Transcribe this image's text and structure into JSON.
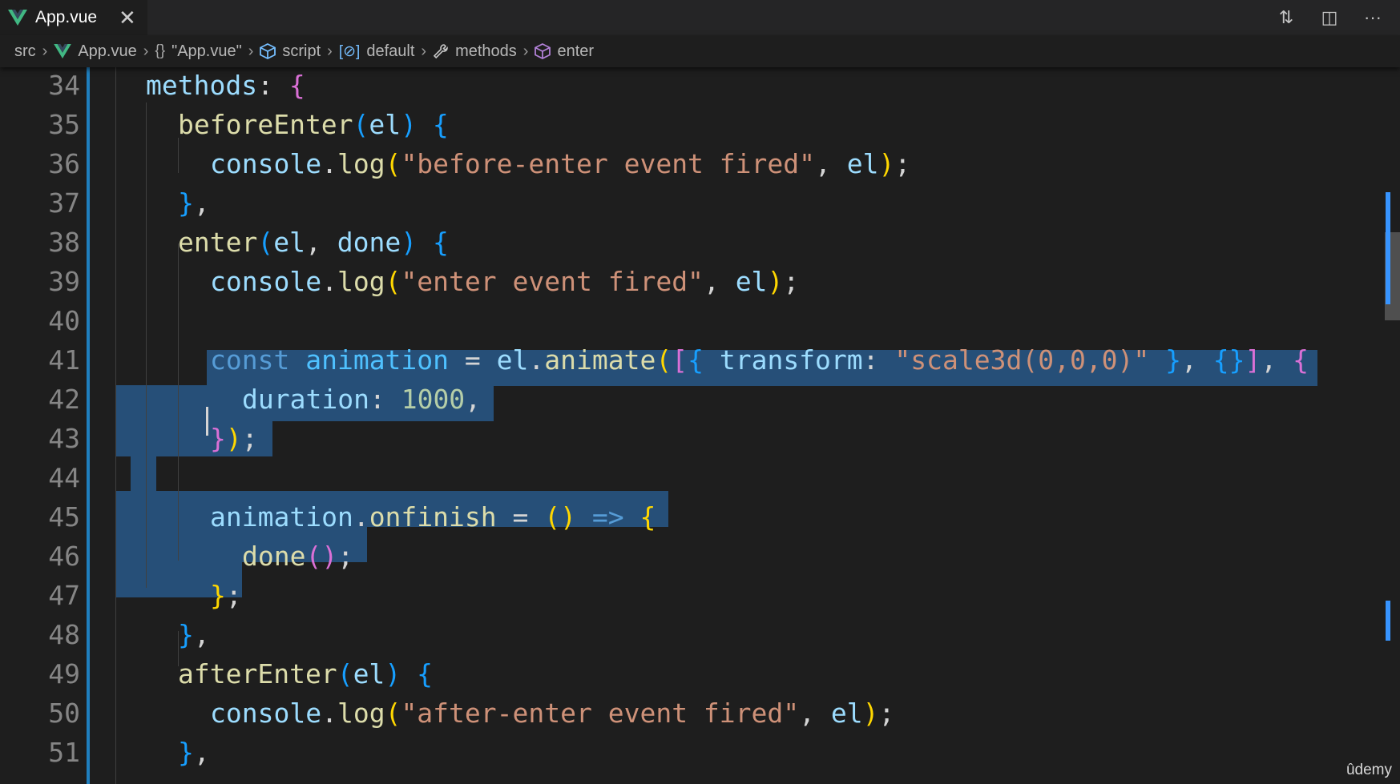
{
  "tab": {
    "label": "App.vue",
    "close": "✕"
  },
  "actions": {
    "compare": "⇅",
    "split": "◫",
    "more": "···"
  },
  "breadcrumb": {
    "items": [
      "src",
      "App.vue",
      "\"App.vue\"",
      "script",
      "default",
      "methods",
      "enter"
    ],
    "icons": [
      "",
      "V",
      "{}",
      "⬡",
      "[⊘]",
      "🔧",
      "⬡"
    ]
  },
  "lines": [
    {
      "n": "34",
      "html": "<span class='var'>methods</span><span class='punc'>: </span><span class='brk2'>{</span>"
    },
    {
      "n": "35",
      "html": "  <span class='fn'>beforeEnter</span><span class='brk3'>(</span><span class='var'>el</span><span class='brk3'>)</span> <span class='brk3'>{</span>"
    },
    {
      "n": "36",
      "html": "    <span class='var'>console</span>.<span class='fn'>log</span><span class='brk1'>(</span><span class='str'>\"before-enter event fired\"</span>, <span class='var'>el</span><span class='brk1'>)</span>;"
    },
    {
      "n": "37",
      "html": "  <span class='brk3'>}</span>,"
    },
    {
      "n": "38",
      "html": "  <span class='fn'>enter</span><span class='brk3'>(</span><span class='var'>el</span>, <span class='var'>done</span><span class='brk3'>)</span> <span class='brk3'>{</span>"
    },
    {
      "n": "39",
      "html": "    <span class='var'>console</span>.<span class='fn'>log</span><span class='brk1'>(</span><span class='str'>\"enter event fired\"</span>, <span class='var'>el</span><span class='brk1'>)</span>;"
    },
    {
      "n": "40",
      "html": ""
    },
    {
      "n": "41",
      "html": "    <span class='kw'>const</span> <span class='con'>animation</span> = <span class='var'>el</span>.<span class='fn'>animate</span><span class='brk1'>(</span><span class='brk2'>[</span><span class='brk3'>{</span> <span class='var'>transform</span>: <span class='str'>\"scale3d(0,0,0)\"</span> <span class='brk3'>}</span>, <span class='brk3'>{}</span><span class='brk2'>]</span>, <span class='brk2'>{</span>"
    },
    {
      "n": "42",
      "html": "      <span class='var'>duration</span>: <span class='num'>1000</span>,"
    },
    {
      "n": "43",
      "html": "    <span class='brk2'>}</span><span class='brk1'>)</span>;"
    },
    {
      "n": "44",
      "html": ""
    },
    {
      "n": "45",
      "html": "    <span class='var'>animation</span>.<span class='fn'>onfinish</span> = <span class='brk1'>()</span> <span class='kw'>=&gt;</span> <span class='brk1'>{</span>"
    },
    {
      "n": "46",
      "html": "      <span class='fn'>done</span><span class='brk2'>()</span>;"
    },
    {
      "n": "47",
      "html": "    <span class='brk1'>}</span>;"
    },
    {
      "n": "48",
      "html": "  <span class='brk3'>}</span>,"
    },
    {
      "n": "49",
      "html": "  <span class='fn'>afterEnter</span><span class='brk3'>(</span><span class='var'>el</span><span class='brk3'>)</span> <span class='brk3'>{</span>"
    },
    {
      "n": "50",
      "html": "    <span class='var'>console</span>.<span class='fn'>log</span><span class='brk1'>(</span><span class='str'>\"after-enter event fired\"</span>, <span class='var'>el</span><span class='brk1'>)</span>;"
    },
    {
      "n": "51",
      "html": "  <span class='brk3'>}</span>,"
    }
  ],
  "watermark": "ûdemy",
  "colors": {
    "selection": "#264f78",
    "gutter_accent": "#1f7fbf"
  }
}
